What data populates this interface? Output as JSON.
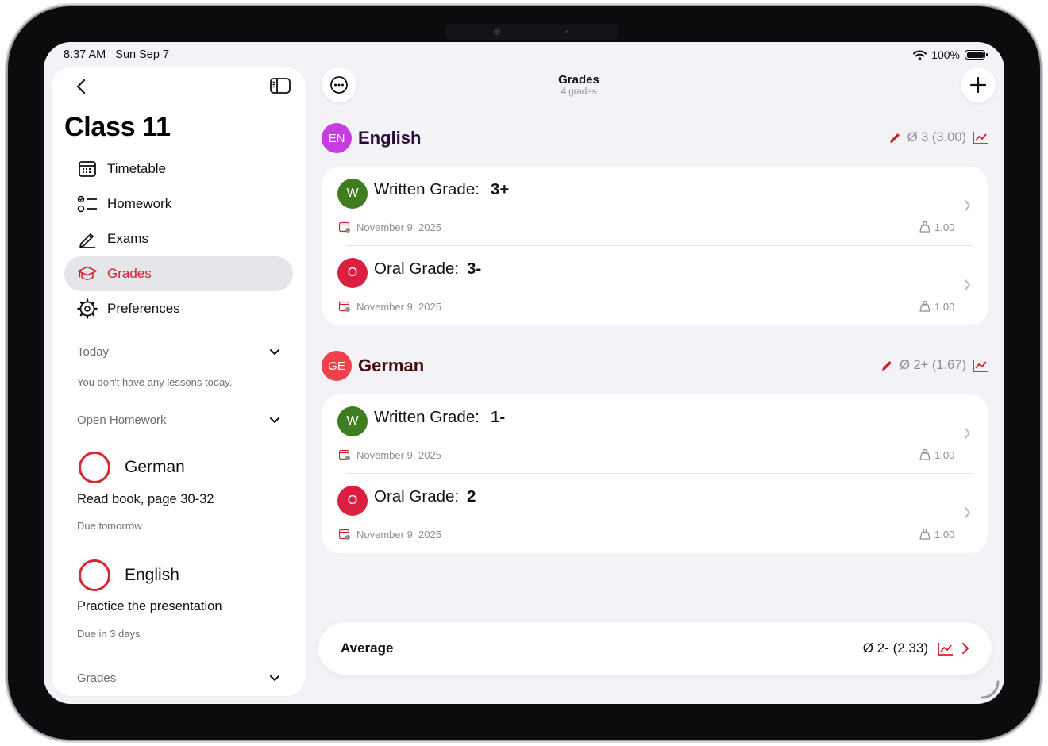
{
  "status": {
    "time": "8:37 AM",
    "date": "Sun Sep 7",
    "battery": "100%"
  },
  "sidebar": {
    "title": "Class 11",
    "nav": [
      {
        "label": "Timetable",
        "icon": "calendar-icon"
      },
      {
        "label": "Homework",
        "icon": "checklist-icon"
      },
      {
        "label": "Exams",
        "icon": "pencil-icon"
      },
      {
        "label": "Grades",
        "icon": "graduation-cap-icon",
        "active": true
      },
      {
        "label": "Preferences",
        "icon": "gear-icon"
      }
    ],
    "today": {
      "label": "Today",
      "empty_text": "You don't have any lessons today."
    },
    "open_homework": {
      "label": "Open Homework",
      "items": [
        {
          "subject": "German",
          "task": "Read book, page 30-32",
          "due": "Due tomorrow"
        },
        {
          "subject": "English",
          "task": "Practice the presentation",
          "due": "Due in 3 days"
        }
      ]
    },
    "grades_section": {
      "label": "Grades"
    }
  },
  "header": {
    "title": "Grades",
    "subtitle": "4 grades"
  },
  "subjects": [
    {
      "abbr": "EN",
      "name": "English",
      "color": "#c73ee0",
      "name_color": "#2a0b3a",
      "average": "Ø 3 (3.00)",
      "grades": [
        {
          "type": "Written Grade:",
          "value": "3+",
          "badge": "W",
          "badge_color": "#3f7d20",
          "date": "November 9, 2025",
          "weight": "1.00"
        },
        {
          "type": "Oral Grade:",
          "value": "3-",
          "badge": "O",
          "badge_color": "#dc1f40",
          "date": "November 9, 2025",
          "weight": "1.00"
        }
      ]
    },
    {
      "abbr": "GE",
      "name": "German",
      "color": "#f0404a",
      "name_color": "#4a0a0c",
      "average": "Ø 2+ (1.67)",
      "grades": [
        {
          "type": "Written Grade:",
          "value": "1-",
          "badge": "W",
          "badge_color": "#3f7d20",
          "date": "November 9, 2025",
          "weight": "1.00"
        },
        {
          "type": "Oral Grade:",
          "value": "2",
          "badge": "O",
          "badge_color": "#dc1f40",
          "date": "November 9, 2025",
          "weight": "1.00"
        }
      ]
    }
  ],
  "summary": {
    "label": "Average",
    "value": "Ø 2- (2.33)"
  },
  "colors": {
    "accent": "#d0202c"
  }
}
